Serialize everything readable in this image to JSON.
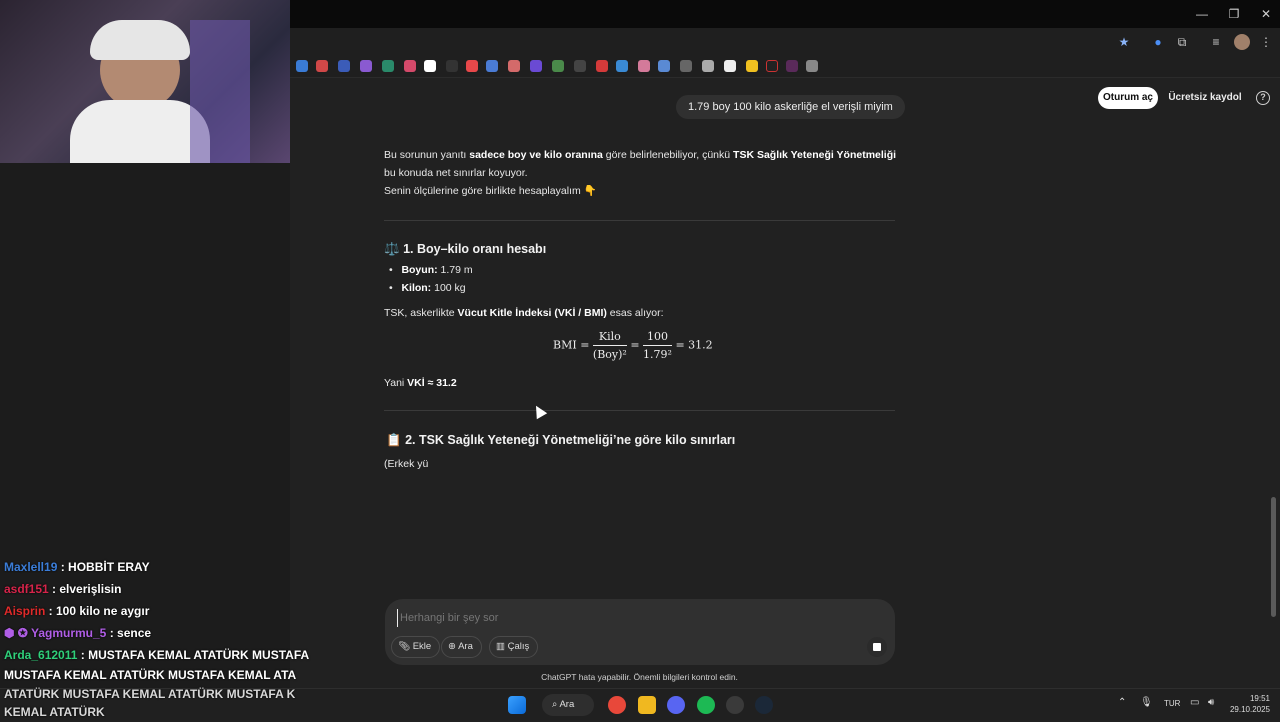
{
  "browser": {
    "window_controls": [
      "—",
      "❐",
      "✕"
    ]
  },
  "header": {
    "user_message": "1.79 boy 100 kilo askerliğe el verişli miyim",
    "login_label": "Oturum aç",
    "signup_label": "Ücretsiz kaydol",
    "help_icon": "?"
  },
  "answer": {
    "intro_1_pre": "Bu sorunun yanıtı ",
    "intro_1_b1": "sadece boy ve kilo oranına",
    "intro_1_mid": " göre belirlenebiliyor, çünkü ",
    "intro_1_b2": "TSK Sağlık Yeteneği Yönetmeliği",
    "intro_2": "bu konuda net sınırlar koyuyor.",
    "intro_3": "Senin ölçülerine göre birlikte hesaplayalım 👇",
    "section1_emoji": "⚖️",
    "section1_title": "1. Boy–kilo oranı hesabı",
    "height_label": "Boyun:",
    "height_value": " 1.79 m",
    "weight_label": "Kilon:",
    "weight_value": " 100 kg",
    "bmi_pre": "TSK, askerlikte ",
    "bmi_bold": "Vücut Kitle İndeksi (VKİ / BMI)",
    "bmi_post": " esas alıyor:",
    "formula": {
      "lhs": "BMI =",
      "num1": "Kilo",
      "den1": "(Boy)²",
      "eq": "=",
      "num2": "100",
      "den2": "1.79²",
      "result": "= 31.2"
    },
    "result_pre": "Yani ",
    "result_bold": "VKİ ≈ 31.2",
    "section2_emoji": "📋",
    "section2_title": "2. TSK Sağlık Yeteneği Yönetmeliği’ne göre kilo sınırları",
    "partial": "(Erkek yü"
  },
  "composer": {
    "placeholder": "Herhangi bir şey sor",
    "attach_label": "Ekle",
    "search_label": "Ara",
    "study_label": "Çalış",
    "disclaimer": "ChatGPT hata yapabilir. Önemli bilgileri kontrol edin."
  },
  "chat_overlay": [
    {
      "user": "Maxlell19",
      "msg": " : HOBBİT ERAY",
      "color": "#3b7dd8"
    },
    {
      "user": "asdf151",
      "msg": " : elverişlisin",
      "color": "#d6244a"
    },
    {
      "user": "Aisprin",
      "msg": " : 100 kilo ne aygır",
      "color": "#e02a2a"
    },
    {
      "user": "Yagmurmu_5",
      "msg": " : sence",
      "color": "#b05ee6"
    },
    {
      "user": "Arda_612011",
      "msg": " : MUSTAFA KEMAL ATATÜRK MUSTAFA",
      "color": "#2fd07a"
    }
  ],
  "chat_wrap": [
    "MUSTAFA KEMAL ATATÜRK MUSTAFA KEMAL ATA",
    "ATATÜRK MUSTAFA KEMAL ATATÜRK MUSTAFA K",
    "KEMAL ATATÜRK"
  ],
  "taskbar": {
    "search_label": "Ara",
    "lang": "TUR",
    "time": "19:51",
    "date": "29.10.2025"
  }
}
